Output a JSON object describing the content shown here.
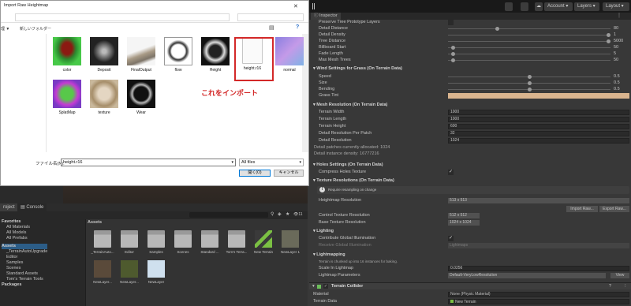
{
  "toolbar": {
    "account": "Account",
    "layers": "Layers",
    "layout": "Layout"
  },
  "dialog": {
    "title": "Import Raw Heightmap",
    "left_labels": [
      "理 ▼",
      "新しいフォルダー"
    ],
    "files": [
      {
        "name": "color",
        "icon": "color-map-thumb"
      },
      {
        "name": "Deposit",
        "icon": "deposit-map-thumb"
      },
      {
        "name": "FinalOutput",
        "icon": "final-output-thumb"
      },
      {
        "name": "flow",
        "icon": "flow-map-thumb"
      },
      {
        "name": "Height",
        "icon": "height-map-thumb"
      },
      {
        "name": "height.r16",
        "icon": "raw-file-icon"
      },
      {
        "name": "normal",
        "icon": "normal-map-thumb"
      },
      {
        "name": "SplatMap",
        "icon": "splat-map-thumb"
      },
      {
        "name": "texture",
        "icon": "texture-thumb"
      },
      {
        "name": "Wear",
        "icon": "wear-map-thumb"
      }
    ],
    "annotation": "これをインポート",
    "filename_label": "ファイル名(N):",
    "filename_value": "height.r16",
    "filetype_value": "All files",
    "open_button": "開く(O)",
    "cancel_button": "キャンセル"
  },
  "project": {
    "tab_project": "roject",
    "tab_console": "Console",
    "count": "11",
    "favorites_header": "Favorites",
    "favorites": [
      "All Materials",
      "All Models",
      "All Prefabs"
    ],
    "assets_header": "Assets",
    "assets_tree": [
      "_TerrainAutoUpgrade",
      "Editor",
      "Samples",
      "Scenes",
      "Standard Assets",
      "Tom's Terrain Tools"
    ],
    "packages_header": "Packages",
    "assets_title": "Assets",
    "items": [
      "_TerrainAuto...",
      "Editor",
      "Samples",
      "Scenes",
      "Standard ...",
      "Tom's Terra...",
      "New Terrain",
      "NewLayer 1",
      "NewLayer...",
      "NewLayer...",
      "NewLayer"
    ]
  },
  "inspector": {
    "tab": "Inspector",
    "tree_rows": [
      {
        "label": "Preserve Tree Prototype Layers"
      },
      {
        "label": "Detail Distance",
        "value": "80",
        "knob": 0.3
      },
      {
        "label": "Detail Density",
        "value": "1",
        "knob": 1.0
      },
      {
        "label": "Tree Distance",
        "value": "5000",
        "knob": 1.0
      },
      {
        "label": "Billboard Start",
        "value": "50",
        "knob": 0.02
      },
      {
        "label": "Fade Length",
        "value": "5",
        "knob": 0.02
      },
      {
        "label": "Max Mesh Trees",
        "value": "50",
        "knob": 0.02
      }
    ],
    "wind_header": "Wind Settings for Grass (On Terrain Data)",
    "wind_rows": [
      {
        "label": "Speed",
        "value": "0.5",
        "knob": 0.5
      },
      {
        "label": "Size",
        "value": "0.5",
        "knob": 0.5
      },
      {
        "label": "Bending",
        "value": "0.5",
        "knob": 0.5
      }
    ],
    "grass_tint_label": "Grass Tint",
    "grass_tint_color": "#d9b48e",
    "mesh_header": "Mesh Resolution (On Terrain Data)",
    "mesh_rows": [
      {
        "label": "Terrain Width",
        "value": "1000"
      },
      {
        "label": "Terrain Length",
        "value": "1000"
      },
      {
        "label": "Terrain Height",
        "value": "600"
      },
      {
        "label": "Detail Resolution Per Patch",
        "value": "32"
      },
      {
        "label": "Detail Resolution",
        "value": "1024"
      }
    ],
    "detail_info_1": "Detail patches currently allocated: 1024",
    "detail_info_2": "Detail instance density: 16777216",
    "holes_header": "Holes Settings (On Terrain Data)",
    "compress_holes": "Compress Holes Texture",
    "texres_header": "Texture Resolutions (On Terrain Data)",
    "resample_note": "Require resampling on change",
    "heightmap_res_label": "Heightmap Resolution",
    "heightmap_res_value": "513 x 513",
    "import_raw": "Import Raw...",
    "export_raw": "Export Raw...",
    "control_tex_label": "Control Texture Resolution",
    "control_tex_value": "512 x 512",
    "base_tex_label": "Base Texture Resolution",
    "base_tex_value": "1024 x 1024",
    "lighting_header": "Lighting",
    "contribute_gi": "Contribute Global Illumination",
    "receive_gi": "Receive Global Illumination",
    "receive_gi_value": "Lightmaps",
    "lightmapping_header": "Lightmapping",
    "lightmap_note": "Terrain is chunked up into 16 instances for baking.",
    "scale_lightmap_label": "Scale In Lightmap",
    "scale_lightmap_value": "0.0256",
    "lightmap_params_label": "Lightmap Parameters",
    "lightmap_params_value": "Default-VeryLowResolution",
    "view_button": "View",
    "collider_header": "Terrain Collider",
    "material_label": "Material",
    "material_value": "None (Physic Material)",
    "terrain_data_label": "Terrain Data",
    "terrain_data_value": "New Terrain"
  }
}
